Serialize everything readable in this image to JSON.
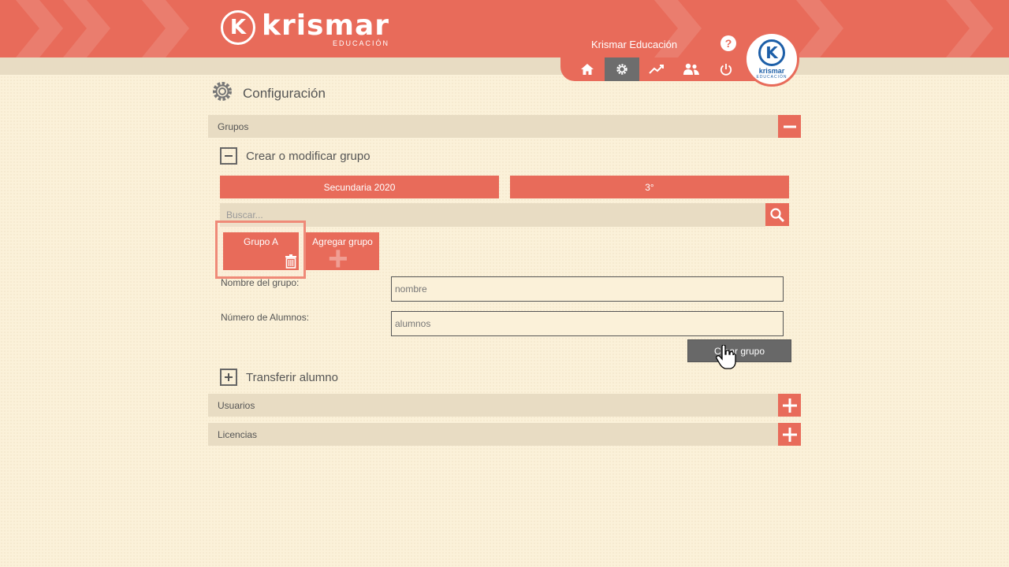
{
  "brand": {
    "name": "krismar",
    "sub": "EDUCACIÓN",
    "badge_name": "krismar",
    "badge_sub": "EDUCACIÓN"
  },
  "header": {
    "user_name": "Krismar Educación",
    "help": "?",
    "nav": [
      {
        "name": "home",
        "icon": "home-icon",
        "active": false
      },
      {
        "name": "settings",
        "icon": "gear-icon",
        "active": true
      },
      {
        "name": "stats",
        "icon": "chart-icon",
        "active": false
      },
      {
        "name": "users",
        "icon": "users-icon",
        "active": false
      },
      {
        "name": "logout",
        "icon": "power-icon",
        "active": false
      }
    ]
  },
  "page": {
    "title": "Configuración"
  },
  "sections": {
    "grupos": "Grupos",
    "usuarios": "Usuarios",
    "licencias": "Licencias"
  },
  "grupos": {
    "crear_title": "Crear o modificar grupo",
    "transferir_title": "Transferir alumno",
    "school": "Secundaria 2020",
    "grade": "3°",
    "search_placeholder": "Buscar...",
    "groups": [
      {
        "label": "Grupo A"
      }
    ],
    "add_group": "Agregar grupo",
    "name_label": "Nombre del grupo:",
    "name_placeholder": "nombre",
    "students_label": "Número de Alumnos:",
    "students_placeholder": "alumnos",
    "create_button": "Crear grupo"
  },
  "colors": {
    "accent": "#e86b5a",
    "background": "#fbf1d9",
    "band": "#e8dcc3",
    "dark_button": "#686868",
    "badge_blue": "#1d5fa8"
  }
}
